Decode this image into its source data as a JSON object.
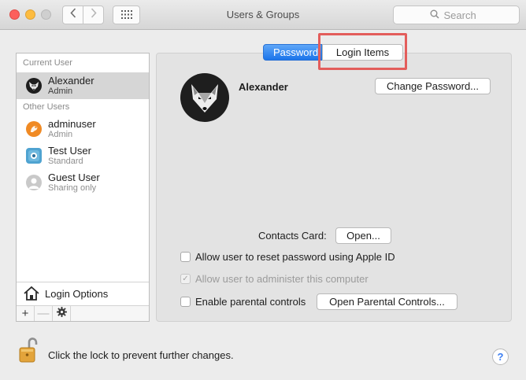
{
  "window": {
    "title": "Users & Groups",
    "search_placeholder": "Search"
  },
  "sidebar": {
    "current_user_header": "Current User",
    "other_users_header": "Other Users",
    "current_user": {
      "name": "Alexander",
      "role": "Admin",
      "icon": "fox-avatar"
    },
    "other_users": [
      {
        "name": "adminuser",
        "role": "Admin",
        "icon": "orange-avatar"
      },
      {
        "name": "Test User",
        "role": "Standard",
        "icon": "blue-avatar"
      },
      {
        "name": "Guest User",
        "role": "Sharing only",
        "icon": "guest-avatar"
      }
    ],
    "login_options_label": "Login Options",
    "add_label": "+",
    "remove_label": "—",
    "actions_icon": "gear-icon"
  },
  "tabs": {
    "password": "Password",
    "login_items": "Login Items"
  },
  "main": {
    "user_name": "Alexander",
    "change_password_button": "Change Password...",
    "contacts_card_label": "Contacts Card:",
    "open_button": "Open...",
    "checkboxes": [
      {
        "label": "Allow user to reset password using Apple ID",
        "checked": false,
        "enabled": true
      },
      {
        "label": "Allow user to administer this computer",
        "checked": true,
        "enabled": false
      },
      {
        "label": "Enable parental controls",
        "checked": false,
        "enabled": true
      }
    ],
    "open_parental_controls_button": "Open Parental Controls..."
  },
  "footer": {
    "lock_text": "Click the lock to prevent further changes.",
    "help_label": "?"
  },
  "colors": {
    "accent_tab": "#1b74ea",
    "highlight_box": "#e35d5b"
  }
}
